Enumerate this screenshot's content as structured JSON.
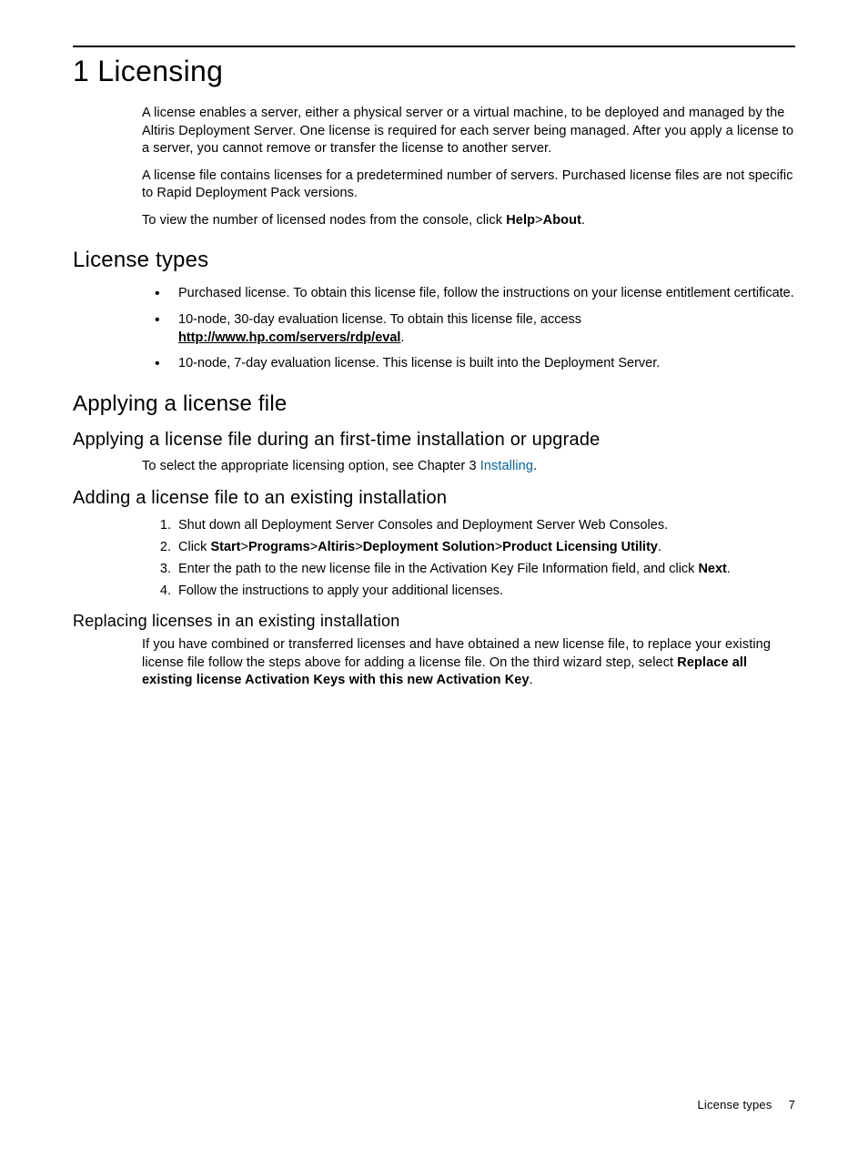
{
  "chapter": {
    "title": "1 Licensing"
  },
  "intro": {
    "p1": "A license enables a server, either a physical server or a virtual machine, to be deployed and managed by the Altiris Deployment Server. One license is required for each server being managed. After you apply a license to a server, you cannot remove or transfer the license to another server.",
    "p2": "A license file contains licenses for a predetermined number of servers. Purchased license files are not specific to Rapid Deployment Pack versions.",
    "p3_pre": "To view the number of licensed nodes from the console, click ",
    "p3_b1": "Help",
    "p3_sep": ">",
    "p3_b2": "About",
    "p3_post": "."
  },
  "license_types": {
    "heading": "License types",
    "item1": "Purchased license. To obtain this license file, follow the instructions on your license entitlement certificate.",
    "item2_pre": "10-node, 30-day evaluation license. To obtain this license file, access ",
    "item2_link": "http://www.hp.com/servers/rdp/eval",
    "item2_post": ".",
    "item3": "10-node, 7-day evaluation license. This license is built into the Deployment Server."
  },
  "applying": {
    "heading": "Applying a license file",
    "sub1": {
      "heading": "Applying a license file during an first-time installation or upgrade",
      "p1_pre": "To select the appropriate licensing option, see Chapter 3 ",
      "p1_link": "Installing",
      "p1_post": "."
    },
    "sub2": {
      "heading": "Adding a license file to an existing installation",
      "step1": "Shut down all Deployment Server Consoles and Deployment Server Web Consoles.",
      "step2_pre": "Click ",
      "step2_b1": "Start",
      "step2_s1": ">",
      "step2_b2": "Programs",
      "step2_s2": ">",
      "step2_b3": "Altiris",
      "step2_s3": ">",
      "step2_b4": "Deployment Solution",
      "step2_s4": ">",
      "step2_b5": "Product Licensing Utility",
      "step2_post": ".",
      "step3_pre": "Enter the path to the new license file in the Activation Key File Information field, and click ",
      "step3_b1": "Next",
      "step3_post": ".",
      "step4": "Follow the instructions to apply your additional licenses."
    },
    "sub3": {
      "heading": "Replacing licenses in an existing installation",
      "p_pre": "If you have combined or transferred licenses and have obtained a new license file, to replace your existing license file follow the steps above for adding a license file. On the third wizard step, select ",
      "p_b1": "Replace all existing license Activation Keys with this new Activation Key",
      "p_post": "."
    }
  },
  "footer": {
    "label": "License types",
    "page": "7"
  }
}
